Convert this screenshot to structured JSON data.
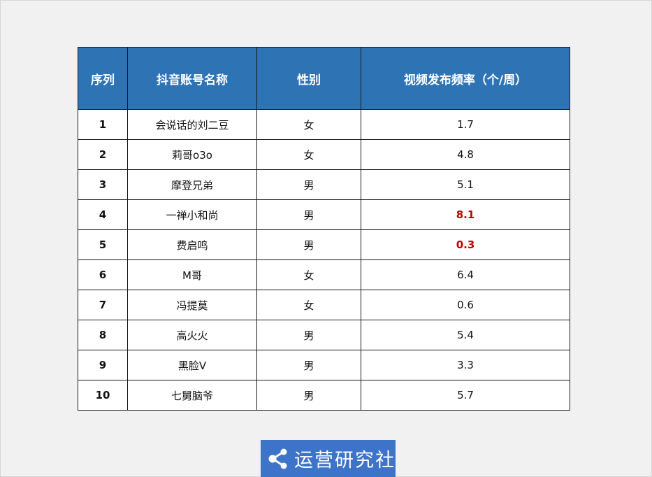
{
  "table": {
    "headers": [
      "序列",
      "抖音账号名称",
      "性别",
      "视频发布频率（个/周）"
    ],
    "rows": [
      {
        "index": "1",
        "name": "会说话的刘二豆",
        "gender": "女",
        "freq": "1.7",
        "highlight": false
      },
      {
        "index": "2",
        "name": "莉哥o3o",
        "gender": "女",
        "freq": "4.8",
        "highlight": false
      },
      {
        "index": "3",
        "name": "摩登兄弟",
        "gender": "男",
        "freq": "5.1",
        "highlight": false
      },
      {
        "index": "4",
        "name": "一禅小和尚",
        "gender": "男",
        "freq": "8.1",
        "highlight": true
      },
      {
        "index": "5",
        "name": "费启鸣",
        "gender": "男",
        "freq": "0.3",
        "highlight": true
      },
      {
        "index": "6",
        "name": "M哥",
        "gender": "女",
        "freq": "6.4",
        "highlight": false
      },
      {
        "index": "7",
        "name": "冯提莫",
        "gender": "女",
        "freq": "0.6",
        "highlight": false
      },
      {
        "index": "8",
        "name": "高火火",
        "gender": "男",
        "freq": "5.4",
        "highlight": false
      },
      {
        "index": "9",
        "name": "黑脸V",
        "gender": "男",
        "freq": "3.3",
        "highlight": false
      },
      {
        "index": "10",
        "name": "七舅脑爷",
        "gender": "男",
        "freq": "5.7",
        "highlight": false
      }
    ]
  },
  "logo": {
    "text": "运营研究社",
    "icon": "share-icon",
    "background": "#3d73c8"
  },
  "colors": {
    "header_bg": "#2e74b5",
    "highlight": "#c00000",
    "page_bg": "#f1f1f1"
  }
}
